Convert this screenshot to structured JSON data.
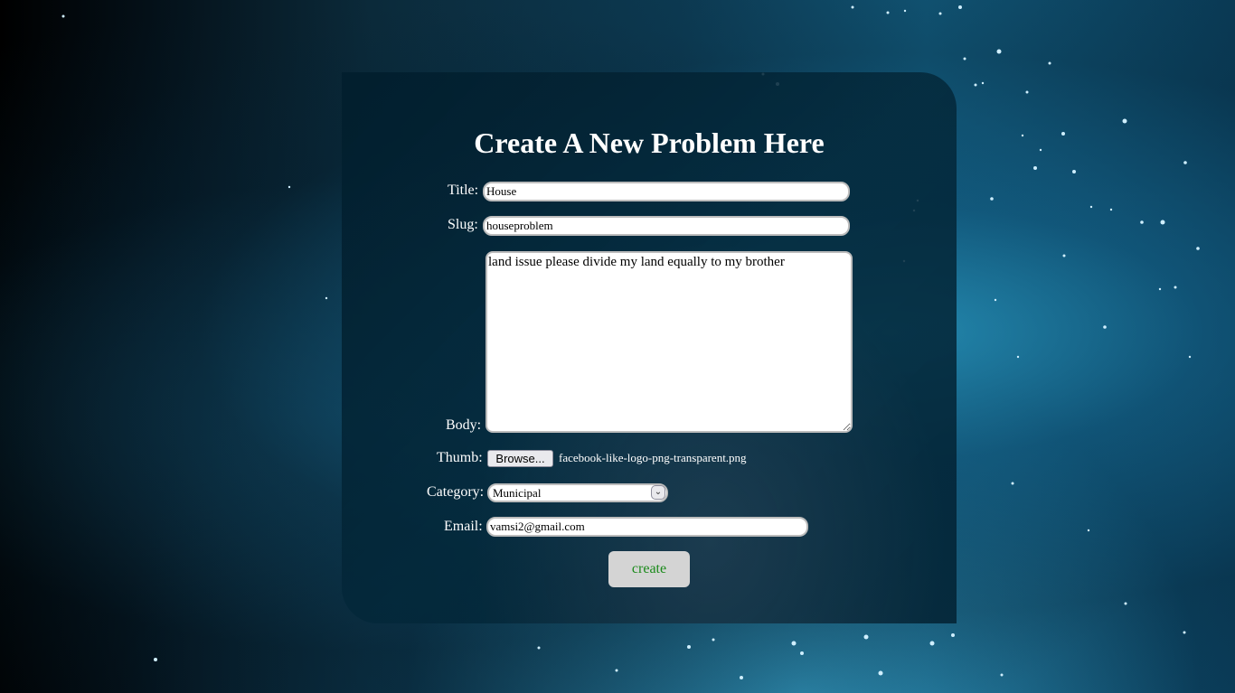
{
  "form": {
    "heading": "Create A New Problem Here",
    "title_label": "Title:",
    "title_value": "House",
    "slug_label": "Slug:",
    "slug_value": "houseproblem",
    "body_label": "Body:",
    "body_value": "land issue please divide my land equally to my brother",
    "thumb_label": "Thumb:",
    "browse_label": "Browse...",
    "thumb_filename": "facebook-like-logo-png-transparent.png",
    "category_label": "Category:",
    "category_value": "Municipal",
    "email_label": "Email:",
    "email_value": "vamsi2@gmail.com",
    "submit_label": "create"
  },
  "icons": {
    "select_arrow": "chevron-down-icon"
  },
  "colors": {
    "submit_text": "#1a8a1a",
    "submit_bg": "#d4d4d4",
    "label_text": "#ffffff"
  }
}
